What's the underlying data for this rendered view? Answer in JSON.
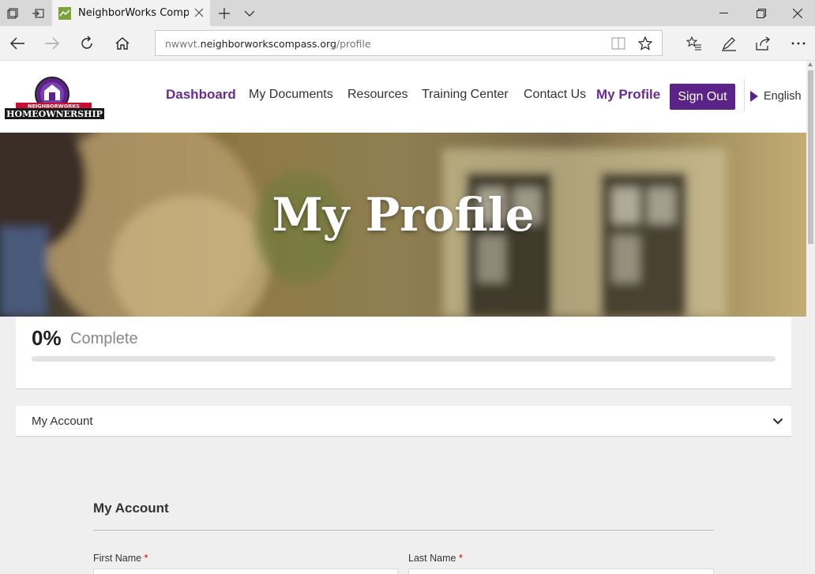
{
  "browser": {
    "tab_title": "NeighborWorks Compa",
    "url_prefix": "nwwvt.",
    "url_host": "neighborworkscompass.org",
    "url_path": "/profile"
  },
  "site": {
    "logo_text_top": "NEIGHBORWORKS",
    "logo_text_bottom": "HOMEOWNERSHIP",
    "nav": {
      "dashboard": "Dashboard",
      "my_documents": "My Documents",
      "resources": "Resources",
      "training_center": "Training Center",
      "contact_us": "Contact Us",
      "my_profile": "My Profile",
      "sign_out": "Sign Out",
      "language": "English"
    },
    "accent_color": "#5b2387"
  },
  "hero": {
    "title": "My Profile"
  },
  "progress": {
    "percent_text": "0%",
    "label": "Complete",
    "value": 0
  },
  "accordion": {
    "label": "My Account"
  },
  "form": {
    "section_title": "My Account",
    "first_name_label": "First Name",
    "last_name_label": "Last Name",
    "required_mark": "*"
  }
}
